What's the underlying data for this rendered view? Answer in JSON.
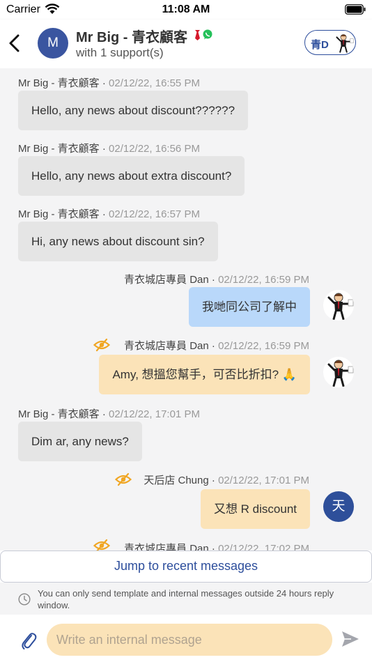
{
  "status_bar": {
    "carrier": "Carrier",
    "time": "11:08 AM"
  },
  "header": {
    "title": "Mr Big - 青衣顧客",
    "subtitle": "with 1 support(s)",
    "avatar_letter": "M",
    "store_chip_label": "青D",
    "icons": [
      "back-icon",
      "tie-icon",
      "whatsapp-icon",
      "staff-figure-icon"
    ]
  },
  "messages": [
    {
      "direction": "incoming",
      "sender": "Mr Big - 青衣顧客",
      "time": "02/12/22, 16:55 PM",
      "text": "Hello, any news about discount??????"
    },
    {
      "direction": "incoming",
      "sender": "Mr Big - 青衣顧客",
      "time": "02/12/22, 16:56 PM",
      "text": "Hello, any news about extra discount?"
    },
    {
      "direction": "incoming",
      "sender": "Mr Big - 青衣顧客",
      "time": "02/12/22, 16:57 PM",
      "text": "Hi, any news about discount sin?"
    },
    {
      "direction": "outgoing",
      "sender": "青衣城店專員 Dan",
      "time": "02/12/22, 16:59 PM",
      "text": "我哋同公司了解中",
      "internal": false
    },
    {
      "direction": "outgoing",
      "sender": "青衣城店專員 Dan",
      "time": "02/12/22, 16:59 PM",
      "text": "Amy, 想搵您幫手，可否比折扣? 🙏",
      "internal": true
    },
    {
      "direction": "incoming",
      "sender": "Mr Big - 青衣顧客",
      "time": "02/12/22, 17:01 PM",
      "text": "Dim ar, any news?"
    },
    {
      "direction": "outgoing",
      "sender": "天后店 Chung",
      "time": "02/12/22, 17:01 PM",
      "text": "又想 R discount",
      "internal": true,
      "avatar_letter": "天"
    },
    {
      "direction": "outgoing",
      "sender": "青衣城店專員 Dan",
      "time": "02/12/22, 17:02 PM",
      "text": "",
      "internal": true
    }
  ],
  "jump_label": "Jump to recent messages",
  "notice": "You can only send template and internal messages outside 24 hours reply window.",
  "composer": {
    "placeholder": "Write an internal message",
    "value": ""
  },
  "colors": {
    "accent": "#2d4e9c",
    "incoming_bubble": "#e5e5e5",
    "outgoing_bubble": "#b9d8fa",
    "internal_bubble": "#fbe3b8",
    "internal_eye": "#f0a623"
  }
}
